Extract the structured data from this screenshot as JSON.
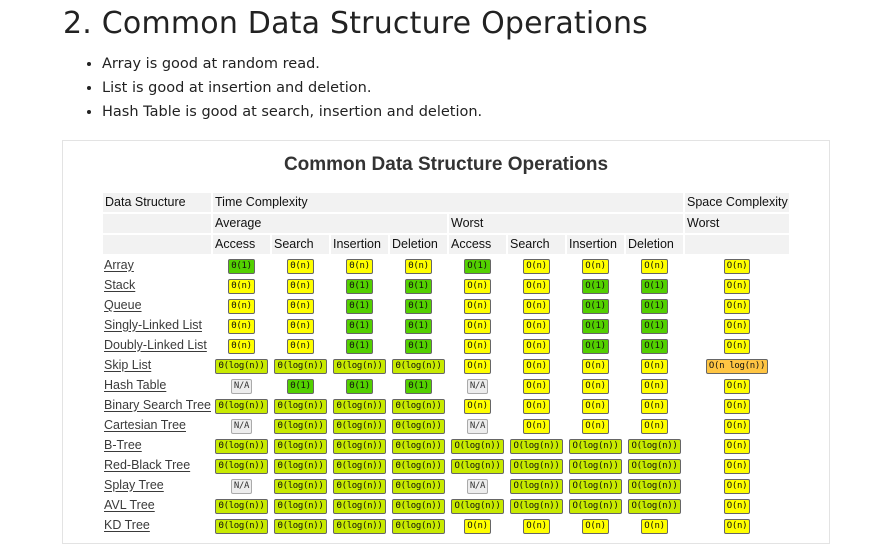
{
  "heading": "2. Common Data Structure Operations",
  "bullets": [
    "Array is good at random read.",
    "List is good at insertion and deletion.",
    "Hash Table is good at search, insertion and deletion."
  ],
  "figure": {
    "title": "Common Data Structure Operations",
    "header": {
      "data_structure": "Data Structure",
      "time_complexity": "Time Complexity",
      "space_complexity": "Space Complexity",
      "average": "Average",
      "worst_time": "Worst",
      "worst_space": "Worst",
      "ops": [
        "Access",
        "Search",
        "Insertion",
        "Deletion",
        "Access",
        "Search",
        "Insertion",
        "Deletion"
      ]
    },
    "legend_colors": {
      "g": "#53d000",
      "y": "#c8ea00",
      "w": "#ffff00",
      "o": "#ffc543",
      "n": "#ededed"
    },
    "rows": [
      {
        "name": "Array",
        "cells": [
          [
            "Θ(1)",
            "g"
          ],
          [
            "Θ(n)",
            "w"
          ],
          [
            "Θ(n)",
            "w"
          ],
          [
            "Θ(n)",
            "w"
          ],
          [
            "O(1)",
            "g"
          ],
          [
            "O(n)",
            "w"
          ],
          [
            "O(n)",
            "w"
          ],
          [
            "O(n)",
            "w"
          ],
          [
            "O(n)",
            "w"
          ]
        ]
      },
      {
        "name": "Stack",
        "cells": [
          [
            "Θ(n)",
            "w"
          ],
          [
            "Θ(n)",
            "w"
          ],
          [
            "Θ(1)",
            "g"
          ],
          [
            "Θ(1)",
            "g"
          ],
          [
            "O(n)",
            "w"
          ],
          [
            "O(n)",
            "w"
          ],
          [
            "O(1)",
            "g"
          ],
          [
            "O(1)",
            "g"
          ],
          [
            "O(n)",
            "w"
          ]
        ]
      },
      {
        "name": "Queue",
        "cells": [
          [
            "Θ(n)",
            "w"
          ],
          [
            "Θ(n)",
            "w"
          ],
          [
            "Θ(1)",
            "g"
          ],
          [
            "Θ(1)",
            "g"
          ],
          [
            "O(n)",
            "w"
          ],
          [
            "O(n)",
            "w"
          ],
          [
            "O(1)",
            "g"
          ],
          [
            "O(1)",
            "g"
          ],
          [
            "O(n)",
            "w"
          ]
        ]
      },
      {
        "name": "Singly-Linked List",
        "cells": [
          [
            "Θ(n)",
            "w"
          ],
          [
            "Θ(n)",
            "w"
          ],
          [
            "Θ(1)",
            "g"
          ],
          [
            "Θ(1)",
            "g"
          ],
          [
            "O(n)",
            "w"
          ],
          [
            "O(n)",
            "w"
          ],
          [
            "O(1)",
            "g"
          ],
          [
            "O(1)",
            "g"
          ],
          [
            "O(n)",
            "w"
          ]
        ]
      },
      {
        "name": "Doubly-Linked List",
        "cells": [
          [
            "Θ(n)",
            "w"
          ],
          [
            "Θ(n)",
            "w"
          ],
          [
            "Θ(1)",
            "g"
          ],
          [
            "Θ(1)",
            "g"
          ],
          [
            "O(n)",
            "w"
          ],
          [
            "O(n)",
            "w"
          ],
          [
            "O(1)",
            "g"
          ],
          [
            "O(1)",
            "g"
          ],
          [
            "O(n)",
            "w"
          ]
        ]
      },
      {
        "name": "Skip List",
        "cells": [
          [
            "Θ(log(n))",
            "y"
          ],
          [
            "Θ(log(n))",
            "y"
          ],
          [
            "Θ(log(n))",
            "y"
          ],
          [
            "Θ(log(n))",
            "y"
          ],
          [
            "O(n)",
            "w"
          ],
          [
            "O(n)",
            "w"
          ],
          [
            "O(n)",
            "w"
          ],
          [
            "O(n)",
            "w"
          ],
          [
            "O(n log(n))",
            "o"
          ]
        ]
      },
      {
        "name": "Hash Table",
        "cells": [
          [
            "N/A",
            "n"
          ],
          [
            "Θ(1)",
            "g"
          ],
          [
            "Θ(1)",
            "g"
          ],
          [
            "Θ(1)",
            "g"
          ],
          [
            "N/A",
            "n"
          ],
          [
            "O(n)",
            "w"
          ],
          [
            "O(n)",
            "w"
          ],
          [
            "O(n)",
            "w"
          ],
          [
            "O(n)",
            "w"
          ]
        ]
      },
      {
        "name": "Binary Search Tree",
        "cells": [
          [
            "Θ(log(n))",
            "y"
          ],
          [
            "Θ(log(n))",
            "y"
          ],
          [
            "Θ(log(n))",
            "y"
          ],
          [
            "Θ(log(n))",
            "y"
          ],
          [
            "O(n)",
            "w"
          ],
          [
            "O(n)",
            "w"
          ],
          [
            "O(n)",
            "w"
          ],
          [
            "O(n)",
            "w"
          ],
          [
            "O(n)",
            "w"
          ]
        ]
      },
      {
        "name": "Cartesian Tree",
        "cells": [
          [
            "N/A",
            "n"
          ],
          [
            "Θ(log(n))",
            "y"
          ],
          [
            "Θ(log(n))",
            "y"
          ],
          [
            "Θ(log(n))",
            "y"
          ],
          [
            "N/A",
            "n"
          ],
          [
            "O(n)",
            "w"
          ],
          [
            "O(n)",
            "w"
          ],
          [
            "O(n)",
            "w"
          ],
          [
            "O(n)",
            "w"
          ]
        ]
      },
      {
        "name": "B-Tree",
        "cells": [
          [
            "Θ(log(n))",
            "y"
          ],
          [
            "Θ(log(n))",
            "y"
          ],
          [
            "Θ(log(n))",
            "y"
          ],
          [
            "Θ(log(n))",
            "y"
          ],
          [
            "O(log(n))",
            "y"
          ],
          [
            "O(log(n))",
            "y"
          ],
          [
            "O(log(n))",
            "y"
          ],
          [
            "O(log(n))",
            "y"
          ],
          [
            "O(n)",
            "w"
          ]
        ]
      },
      {
        "name": "Red-Black Tree",
        "cells": [
          [
            "Θ(log(n))",
            "y"
          ],
          [
            "Θ(log(n))",
            "y"
          ],
          [
            "Θ(log(n))",
            "y"
          ],
          [
            "Θ(log(n))",
            "y"
          ],
          [
            "O(log(n))",
            "y"
          ],
          [
            "O(log(n))",
            "y"
          ],
          [
            "O(log(n))",
            "y"
          ],
          [
            "O(log(n))",
            "y"
          ],
          [
            "O(n)",
            "w"
          ]
        ]
      },
      {
        "name": "Splay Tree",
        "cells": [
          [
            "N/A",
            "n"
          ],
          [
            "Θ(log(n))",
            "y"
          ],
          [
            "Θ(log(n))",
            "y"
          ],
          [
            "Θ(log(n))",
            "y"
          ],
          [
            "N/A",
            "n"
          ],
          [
            "O(log(n))",
            "y"
          ],
          [
            "O(log(n))",
            "y"
          ],
          [
            "O(log(n))",
            "y"
          ],
          [
            "O(n)",
            "w"
          ]
        ]
      },
      {
        "name": "AVL Tree",
        "cells": [
          [
            "Θ(log(n))",
            "y"
          ],
          [
            "Θ(log(n))",
            "y"
          ],
          [
            "Θ(log(n))",
            "y"
          ],
          [
            "Θ(log(n))",
            "y"
          ],
          [
            "O(log(n))",
            "y"
          ],
          [
            "O(log(n))",
            "y"
          ],
          [
            "O(log(n))",
            "y"
          ],
          [
            "O(log(n))",
            "y"
          ],
          [
            "O(n)",
            "w"
          ]
        ]
      },
      {
        "name": "KD Tree",
        "cells": [
          [
            "Θ(log(n))",
            "y"
          ],
          [
            "Θ(log(n))",
            "y"
          ],
          [
            "Θ(log(n))",
            "y"
          ],
          [
            "Θ(log(n))",
            "y"
          ],
          [
            "O(n)",
            "w"
          ],
          [
            "O(n)",
            "w"
          ],
          [
            "O(n)",
            "w"
          ],
          [
            "O(n)",
            "w"
          ],
          [
            "O(n)",
            "w"
          ]
        ]
      }
    ]
  }
}
